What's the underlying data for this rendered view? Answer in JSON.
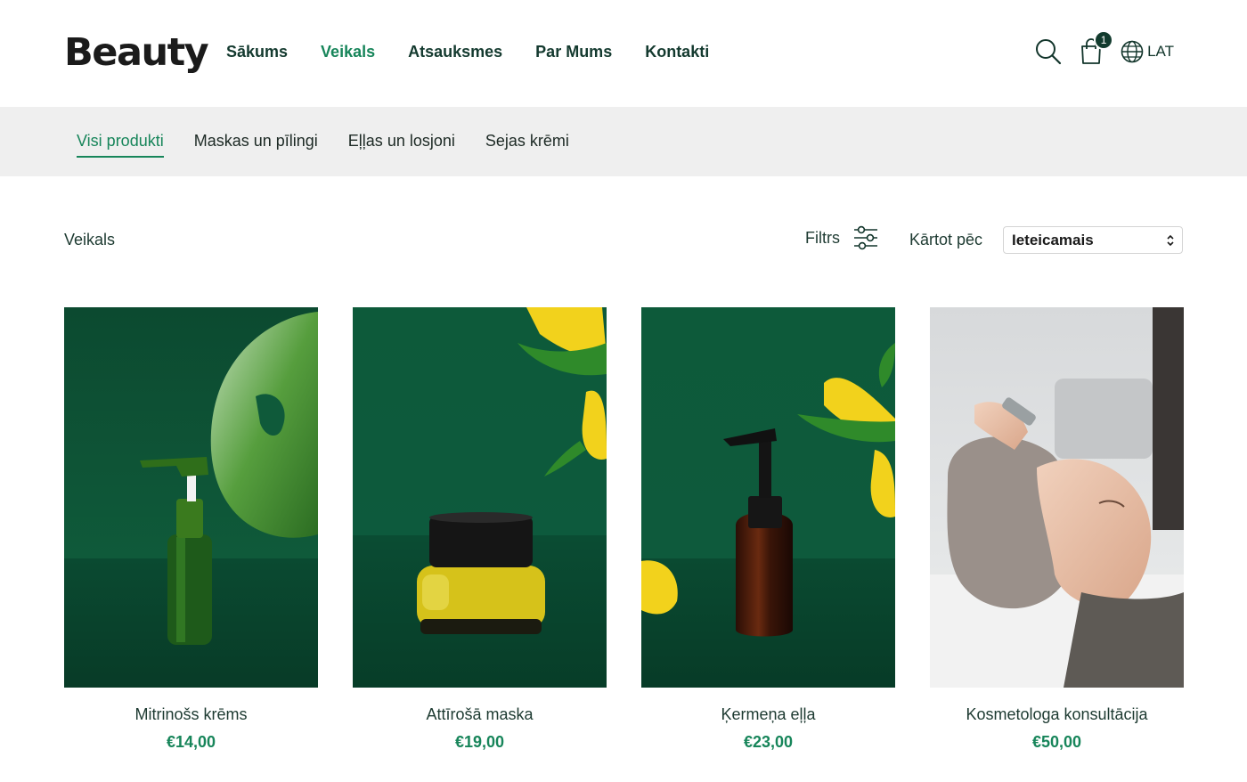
{
  "brand": {
    "logo": "Beauty"
  },
  "nav": {
    "items": [
      {
        "label": "Sākums",
        "active": false
      },
      {
        "label": "Veikals",
        "active": true
      },
      {
        "label": "Atsauksmes",
        "active": false
      },
      {
        "label": "Par Mums",
        "active": false
      },
      {
        "label": "Kontakti",
        "active": false
      }
    ]
  },
  "header": {
    "cart_count": "1",
    "language": "LAT",
    "icons": [
      "search-icon",
      "shopping-bag-icon",
      "globe-icon"
    ]
  },
  "categories": [
    {
      "label": "Visi produkti",
      "active": true
    },
    {
      "label": "Maskas un pīlingi",
      "active": false
    },
    {
      "label": "Eļļas un losjoni",
      "active": false
    },
    {
      "label": "Sejas krēmi",
      "active": false
    }
  ],
  "toolbar": {
    "title": "Veikals",
    "filter_label": "Filtrs",
    "sort_label": "Kārtot pēc",
    "sort_value": "Ieteicamais"
  },
  "products": [
    {
      "name": "Mitrinošs krēms",
      "price": "€14,00"
    },
    {
      "name": "Attīrošā maska",
      "price": "€19,00"
    },
    {
      "name": "Ķermeņa eļļa",
      "price": "€23,00"
    },
    {
      "name": "Kosmetologa konsultācija",
      "price": "€50,00"
    }
  ],
  "colors": {
    "accent": "#17855a",
    "text_dark": "#12352b",
    "category_bar": "#efefef",
    "product_bg": "#0f5a3c"
  }
}
